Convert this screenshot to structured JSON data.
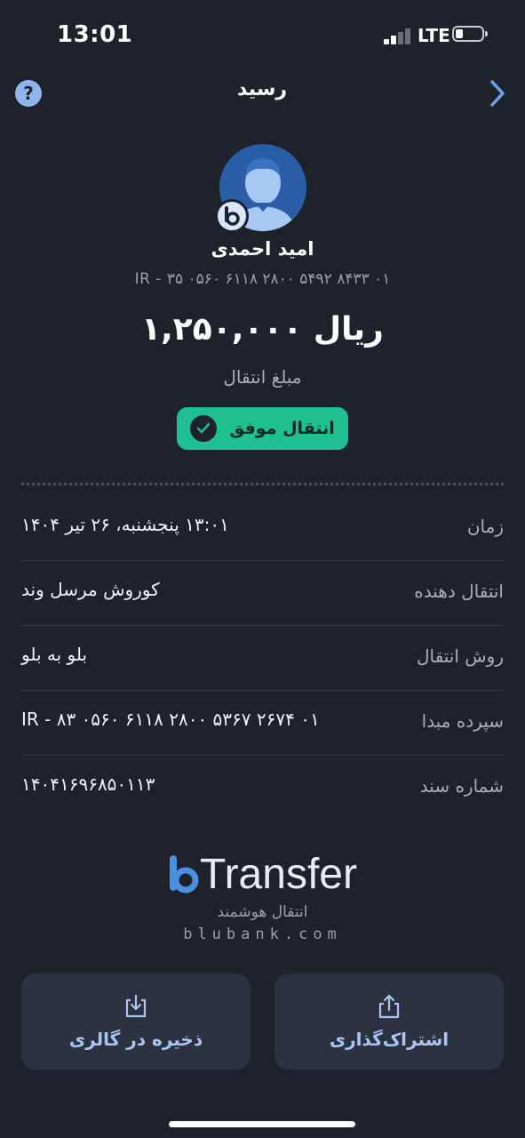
{
  "status_bar": {
    "time": "13:01",
    "network": "LTE"
  },
  "header": {
    "title": "رسید",
    "help_glyph": "?"
  },
  "recipient": {
    "name": "امید احمدی",
    "iban": "IR - ۳۵ ۰۵۶۰ ۶۱۱۸ ۲۸۰۰ ۵۴۹۲ ۸۴۳۳ ۰۱"
  },
  "transfer": {
    "amount": "۱,۲۵۰,۰۰۰ ریال",
    "amount_label": "مبلغ انتقال",
    "status_label": "انتقال موفق"
  },
  "details": [
    {
      "key": "زمان",
      "value": "۱۳:۰۱ پنجشنبه، ۲۶ تیر ۱۴۰۴"
    },
    {
      "key": "انتقال دهنده",
      "value": "کوروش مرسل وند"
    },
    {
      "key": "روش انتقال",
      "value": "بلو به بلو"
    },
    {
      "key": "سپرده مبدا",
      "value": "IR - ۸۳ ۰۵۶۰ ۶۱۱۸ ۲۸۰۰ ۵۳۶۷ ۲۶۷۴ ۰۱"
    },
    {
      "key": "شماره سند",
      "value": "۱۴۰۴۱۶۹۶۸۵۰۱۱۳"
    }
  ],
  "logo": {
    "wordmark": "Transfer",
    "tagline": "انتقال هوشمند",
    "domain": "blubank.com"
  },
  "actions": {
    "share_label": "اشتراک‌گذاری",
    "save_label": "ذخیره در گالری"
  },
  "icons": {
    "help": "help-icon",
    "back": "chevron-right-icon",
    "success": "check-icon",
    "share": "share-icon",
    "save": "download-icon"
  },
  "colors": {
    "background": "#1e222b",
    "accent": "#4a90e2",
    "success": "#1fbf8f",
    "button": "#2c3240"
  }
}
